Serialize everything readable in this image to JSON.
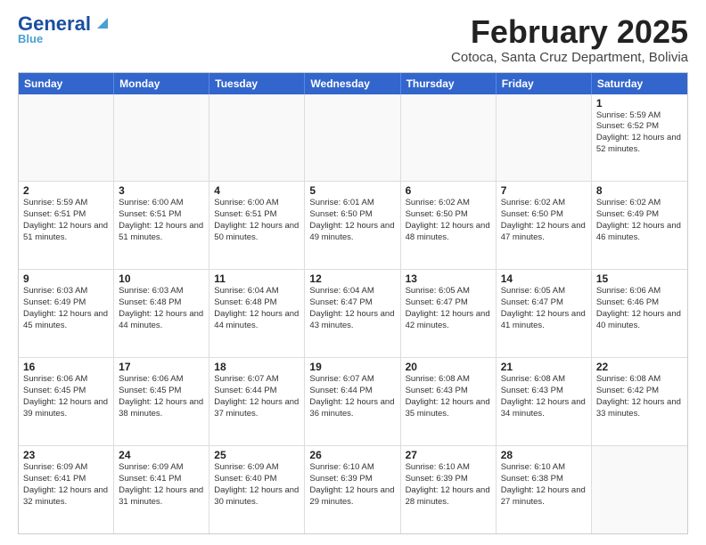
{
  "logo": {
    "line1": "General",
    "line2": "Blue"
  },
  "title": "February 2025",
  "location": "Cotoca, Santa Cruz Department, Bolivia",
  "header": {
    "days": [
      "Sunday",
      "Monday",
      "Tuesday",
      "Wednesday",
      "Thursday",
      "Friday",
      "Saturday"
    ]
  },
  "weeks": [
    {
      "cells": [
        {
          "empty": true
        },
        {
          "empty": true
        },
        {
          "empty": true
        },
        {
          "empty": true
        },
        {
          "empty": true
        },
        {
          "empty": true
        },
        {
          "day": "1",
          "sunrise": "5:59 AM",
          "sunset": "6:52 PM",
          "daylight": "12 hours and 52 minutes."
        }
      ]
    },
    {
      "cells": [
        {
          "day": "2",
          "sunrise": "5:59 AM",
          "sunset": "6:51 PM",
          "daylight": "12 hours and 51 minutes."
        },
        {
          "day": "3",
          "sunrise": "6:00 AM",
          "sunset": "6:51 PM",
          "daylight": "12 hours and 51 minutes."
        },
        {
          "day": "4",
          "sunrise": "6:00 AM",
          "sunset": "6:51 PM",
          "daylight": "12 hours and 50 minutes."
        },
        {
          "day": "5",
          "sunrise": "6:01 AM",
          "sunset": "6:50 PM",
          "daylight": "12 hours and 49 minutes."
        },
        {
          "day": "6",
          "sunrise": "6:02 AM",
          "sunset": "6:50 PM",
          "daylight": "12 hours and 48 minutes."
        },
        {
          "day": "7",
          "sunrise": "6:02 AM",
          "sunset": "6:50 PM",
          "daylight": "12 hours and 47 minutes."
        },
        {
          "day": "8",
          "sunrise": "6:02 AM",
          "sunset": "6:49 PM",
          "daylight": "12 hours and 46 minutes."
        }
      ]
    },
    {
      "cells": [
        {
          "day": "9",
          "sunrise": "6:03 AM",
          "sunset": "6:49 PM",
          "daylight": "12 hours and 45 minutes."
        },
        {
          "day": "10",
          "sunrise": "6:03 AM",
          "sunset": "6:48 PM",
          "daylight": "12 hours and 44 minutes."
        },
        {
          "day": "11",
          "sunrise": "6:04 AM",
          "sunset": "6:48 PM",
          "daylight": "12 hours and 44 minutes."
        },
        {
          "day": "12",
          "sunrise": "6:04 AM",
          "sunset": "6:47 PM",
          "daylight": "12 hours and 43 minutes."
        },
        {
          "day": "13",
          "sunrise": "6:05 AM",
          "sunset": "6:47 PM",
          "daylight": "12 hours and 42 minutes."
        },
        {
          "day": "14",
          "sunrise": "6:05 AM",
          "sunset": "6:47 PM",
          "daylight": "12 hours and 41 minutes."
        },
        {
          "day": "15",
          "sunrise": "6:06 AM",
          "sunset": "6:46 PM",
          "daylight": "12 hours and 40 minutes."
        }
      ]
    },
    {
      "cells": [
        {
          "day": "16",
          "sunrise": "6:06 AM",
          "sunset": "6:45 PM",
          "daylight": "12 hours and 39 minutes."
        },
        {
          "day": "17",
          "sunrise": "6:06 AM",
          "sunset": "6:45 PM",
          "daylight": "12 hours and 38 minutes."
        },
        {
          "day": "18",
          "sunrise": "6:07 AM",
          "sunset": "6:44 PM",
          "daylight": "12 hours and 37 minutes."
        },
        {
          "day": "19",
          "sunrise": "6:07 AM",
          "sunset": "6:44 PM",
          "daylight": "12 hours and 36 minutes."
        },
        {
          "day": "20",
          "sunrise": "6:08 AM",
          "sunset": "6:43 PM",
          "daylight": "12 hours and 35 minutes."
        },
        {
          "day": "21",
          "sunrise": "6:08 AM",
          "sunset": "6:43 PM",
          "daylight": "12 hours and 34 minutes."
        },
        {
          "day": "22",
          "sunrise": "6:08 AM",
          "sunset": "6:42 PM",
          "daylight": "12 hours and 33 minutes."
        }
      ]
    },
    {
      "cells": [
        {
          "day": "23",
          "sunrise": "6:09 AM",
          "sunset": "6:41 PM",
          "daylight": "12 hours and 32 minutes."
        },
        {
          "day": "24",
          "sunrise": "6:09 AM",
          "sunset": "6:41 PM",
          "daylight": "12 hours and 31 minutes."
        },
        {
          "day": "25",
          "sunrise": "6:09 AM",
          "sunset": "6:40 PM",
          "daylight": "12 hours and 30 minutes."
        },
        {
          "day": "26",
          "sunrise": "6:10 AM",
          "sunset": "6:39 PM",
          "daylight": "12 hours and 29 minutes."
        },
        {
          "day": "27",
          "sunrise": "6:10 AM",
          "sunset": "6:39 PM",
          "daylight": "12 hours and 28 minutes."
        },
        {
          "day": "28",
          "sunrise": "6:10 AM",
          "sunset": "6:38 PM",
          "daylight": "12 hours and 27 minutes."
        },
        {
          "empty": true
        }
      ]
    }
  ]
}
